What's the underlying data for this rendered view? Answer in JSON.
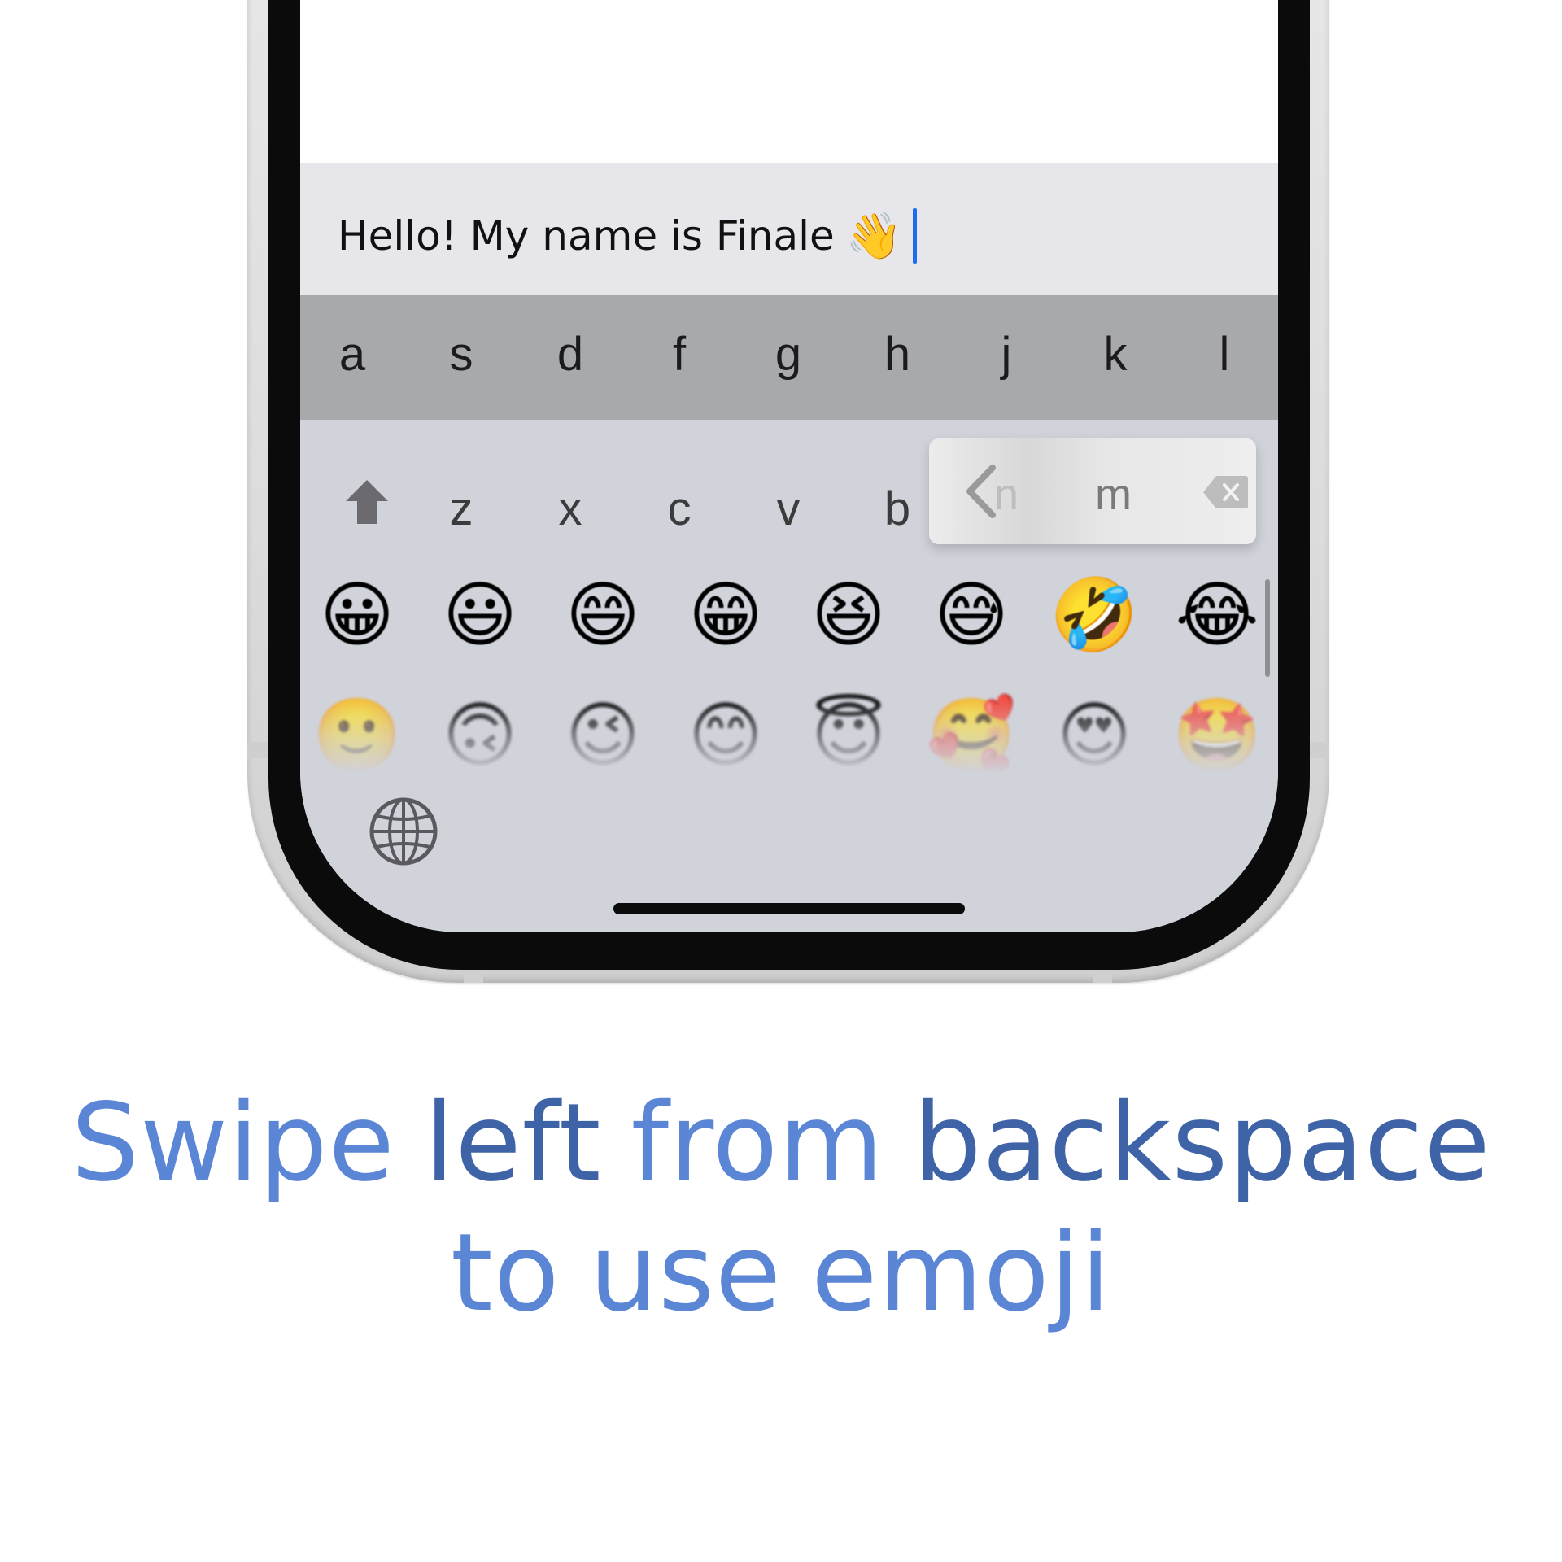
{
  "message_input": {
    "text": "Hello! My name is Finale",
    "emoji": "👋"
  },
  "keyboard": {
    "row1_keys": [
      "a",
      "s",
      "d",
      "f",
      "g",
      "h",
      "j",
      "k",
      "l"
    ],
    "row2_keys": [
      "z",
      "x",
      "c",
      "v",
      "b"
    ],
    "popup": {
      "n": "n",
      "m": "m"
    },
    "emoji_row_1": [
      "😀",
      "😃",
      "😄",
      "😁",
      "😆",
      "😅",
      "🤣",
      "😂"
    ],
    "emoji_row_2": [
      "🙂",
      "🙃",
      "😉",
      "😊",
      "😇",
      "🥰",
      "😍",
      "🤩"
    ]
  },
  "caption": {
    "line1": [
      "Swipe",
      "left",
      "from",
      "backspace"
    ],
    "line2": [
      "to",
      "use",
      "emoji"
    ]
  },
  "colors": {
    "caption_light": "#5b86d6",
    "caption_dark": "#3f63a7",
    "caret": "#1f6cf0"
  },
  "icons": {
    "shift": "up-arrow-icon",
    "delete": "backspace-icon",
    "globe": "globe-icon",
    "popup_chevron": "chevron-left-icon"
  }
}
